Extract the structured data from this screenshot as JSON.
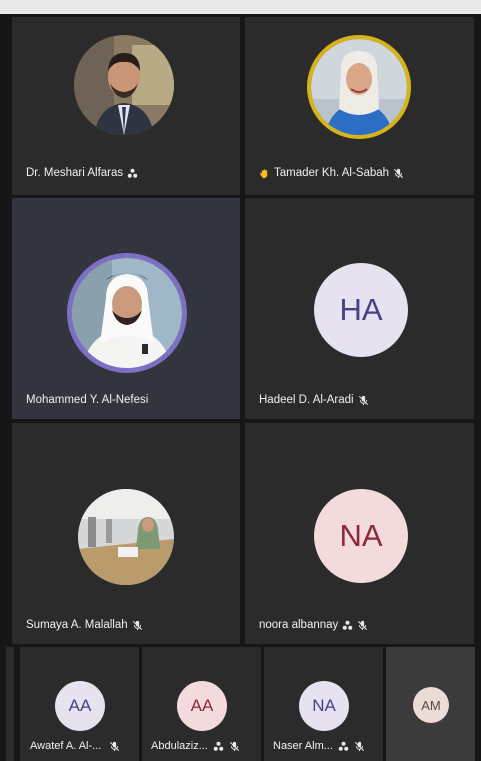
{
  "participants": [
    {
      "name": "Dr. Meshari Alfaras"
    },
    {
      "name": "Tamader Kh. Al-Sabah"
    },
    {
      "name": "Mohammed Y. Al-Nefesi"
    },
    {
      "name": "Hadeel D. Al-Aradi",
      "initials": "HA"
    },
    {
      "name": "Sumaya A. Malallah"
    },
    {
      "name": "noora albannay",
      "initials": "NA"
    }
  ],
  "strip": [
    {
      "name": "Awatef A. Al-...",
      "initials": "AA"
    },
    {
      "name": "Abdulaziz...",
      "initials": "AA"
    },
    {
      "name": "Naser Alm...",
      "initials": "NA"
    },
    {
      "initials": "AM"
    }
  ],
  "colors": {
    "background": "#161616",
    "tile": "#2b2b2b",
    "raised_hand_ring": "#d7b314",
    "active_speaker_ring": "#7c6fc4"
  },
  "icons": [
    "network-icon",
    "mic-muted-icon",
    "raised-hand-icon"
  ]
}
